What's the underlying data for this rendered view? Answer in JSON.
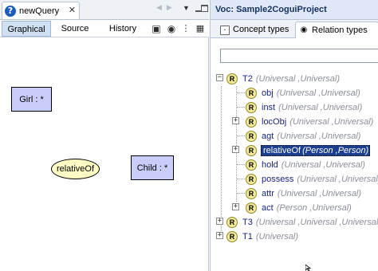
{
  "editor": {
    "tab_title": "newQuery",
    "close_label": "✕",
    "modes": [
      "Graphical",
      "Source",
      "History"
    ],
    "canvas": {
      "concepts": [
        "Girl : *",
        "Child : *"
      ],
      "relation": "relativeOf"
    }
  },
  "vocabulary": {
    "title": "Voc: Sample2CoguiProject",
    "tabs": [
      "Concept types",
      "Relation types"
    ],
    "search": {
      "value": "",
      "placeholder": ""
    },
    "tree": [
      {
        "label": "T2",
        "signature": "(Universal ,Universal)"
      },
      {
        "label": "obj",
        "signature": "(Universal ,Universal)"
      },
      {
        "label": "inst",
        "signature": "(Universal ,Universal)"
      },
      {
        "label": "locObj",
        "signature": "(Universal ,Universal)"
      },
      {
        "label": "agt",
        "signature": "(Universal ,Universal)"
      },
      {
        "label": "relativeOf",
        "signature": "(Person ,Person)"
      },
      {
        "label": "hold",
        "signature": "(Universal ,Universal)"
      },
      {
        "label": "possess",
        "signature": "(Universal ,Universal)"
      },
      {
        "label": "attr",
        "signature": "(Universal ,Universal)"
      },
      {
        "label": "act",
        "signature": "(Person ,Universal)"
      },
      {
        "label": "T3",
        "signature": "(Universal ,Universal ,Universal)"
      },
      {
        "label": "T1",
        "signature": "(Universal)"
      }
    ],
    "relation_icon_letter": "R"
  },
  "colors": {
    "concept_fill": "#c8cdfa",
    "relation_fill": "#fefcc4",
    "selection": "#1b3f8f",
    "voc_title_bg": "#dfe8f6"
  }
}
